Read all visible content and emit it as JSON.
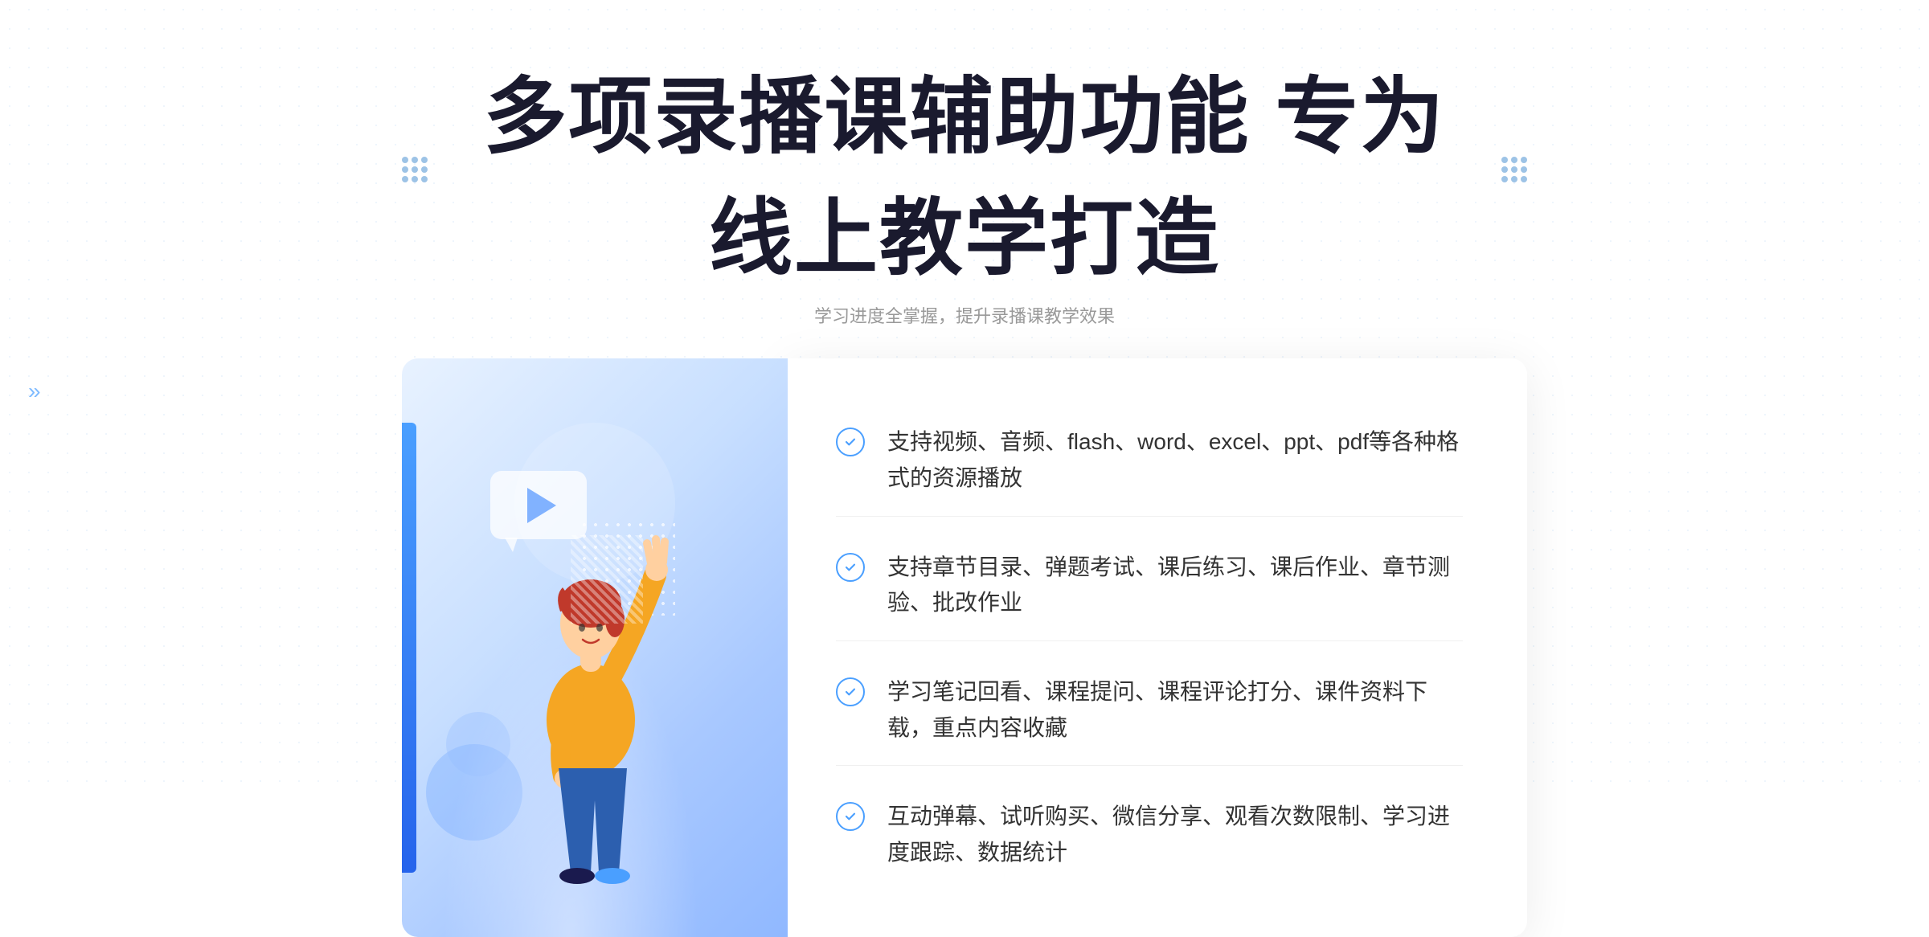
{
  "header": {
    "title": "多项录播课辅助功能 专为线上教学打造",
    "subtitle": "学习进度全掌握，提升录播课教学效果"
  },
  "features": [
    {
      "id": 1,
      "text": "支持视频、音频、flash、word、excel、ppt、pdf等各种格式的资源播放"
    },
    {
      "id": 2,
      "text": "支持章节目录、弹题考试、课后练习、课后作业、章节测验、批改作业"
    },
    {
      "id": 3,
      "text": "学习笔记回看、课程提问、课程评论打分、课件资料下载，重点内容收藏"
    },
    {
      "id": 4,
      "text": "互动弹幕、试听购买、微信分享、观看次数限制、学习进度跟踪、数据统计"
    }
  ],
  "icons": {
    "check": "check-circle-icon",
    "left_arrow": "chevron-left-icon",
    "title_decoration": "dots-grid-icon"
  },
  "colors": {
    "primary": "#4a9fff",
    "primary_dark": "#2563eb",
    "text_dark": "#1a1a2e",
    "text_body": "#333333",
    "text_muted": "#999999",
    "bg_white": "#ffffff",
    "bg_light_blue": "#e8f2ff"
  }
}
